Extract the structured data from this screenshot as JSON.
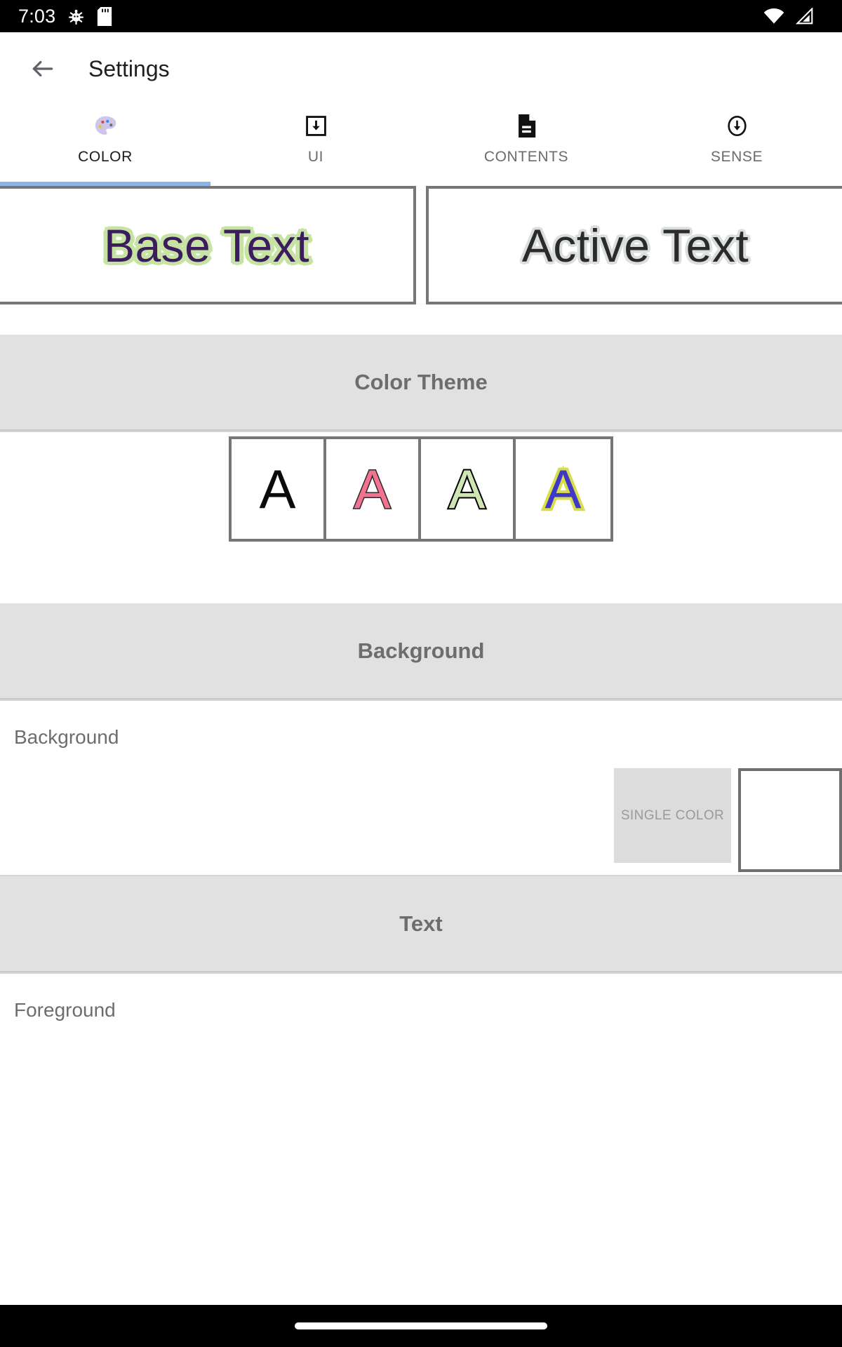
{
  "status_bar": {
    "clock": "7:03",
    "icons_left": [
      "bug-icon",
      "sd-card-icon"
    ],
    "icons_right": [
      "wifi-icon",
      "cellular-signal-icon"
    ]
  },
  "app_bar": {
    "back_label": "",
    "title": "Settings"
  },
  "tabs": [
    {
      "label": "COLOR",
      "icon": "palette-icon",
      "active": true
    },
    {
      "label": "UI",
      "icon": "download-box-icon",
      "active": false
    },
    {
      "label": "CONTENTS",
      "icon": "document-icon",
      "active": false
    },
    {
      "label": "SENSE",
      "icon": "circle-down-arrow-icon",
      "active": false
    }
  ],
  "preview": {
    "base": {
      "text": "Base Text",
      "fill": "#3b1d5e",
      "outline": "#c7e3a3"
    },
    "active": {
      "text": "Active Text",
      "fill": "#2b2b2b",
      "outline": "#dadedd"
    }
  },
  "sections": {
    "color_theme": {
      "title": "Color Theme",
      "swatches": [
        {
          "glyph": "A",
          "fill": "#0b0b0b",
          "outline": "none",
          "selected": false
        },
        {
          "glyph": "A",
          "fill": "#f3728f",
          "outline": "#2b2b2b",
          "selected": false
        },
        {
          "glyph": "A",
          "fill": "#cfe6b3",
          "outline": "#000000",
          "selected": false
        },
        {
          "glyph": "A",
          "fill": "#4038c8",
          "outline": "#d7de4a",
          "selected": false
        }
      ]
    },
    "background": {
      "title": "Background",
      "row_label": "Background",
      "single_color_label": "SINGLE COLOR",
      "color_value": "#ffffff"
    },
    "text": {
      "title": "Text",
      "row_label": "Foreground"
    }
  },
  "nav_bar": {
    "gesture_pill": "home-indicator"
  },
  "colors": {
    "accent": "#8ab4e8",
    "band": "#e1e1e1",
    "border": "#767676",
    "muted_text": "#6d6d6d"
  }
}
